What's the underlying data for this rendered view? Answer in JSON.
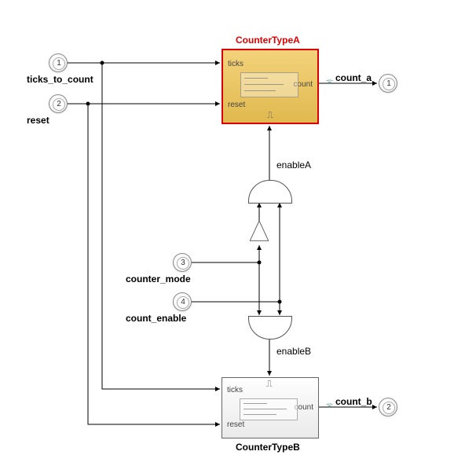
{
  "inputs": {
    "port1": {
      "num": "1",
      "label": "ticks_to_count"
    },
    "port2": {
      "num": "2",
      "label": "reset"
    },
    "port3": {
      "num": "3",
      "label": "counter_mode"
    },
    "port4": {
      "num": "4",
      "label": "count_enable"
    }
  },
  "outputs": {
    "out1": {
      "num": "1",
      "label": "count_a"
    },
    "out2": {
      "num": "2",
      "label": "count_b"
    }
  },
  "blocks": {
    "counterA": {
      "title": "CounterTypeA",
      "port_ticks": "ticks",
      "port_reset": "reset",
      "port_count": "count"
    },
    "counterB": {
      "title": "CounterTypeB",
      "port_ticks": "ticks",
      "port_reset": "reset",
      "port_count": "count"
    }
  },
  "signals": {
    "enableA": "enableA",
    "enableB": "enableB"
  }
}
